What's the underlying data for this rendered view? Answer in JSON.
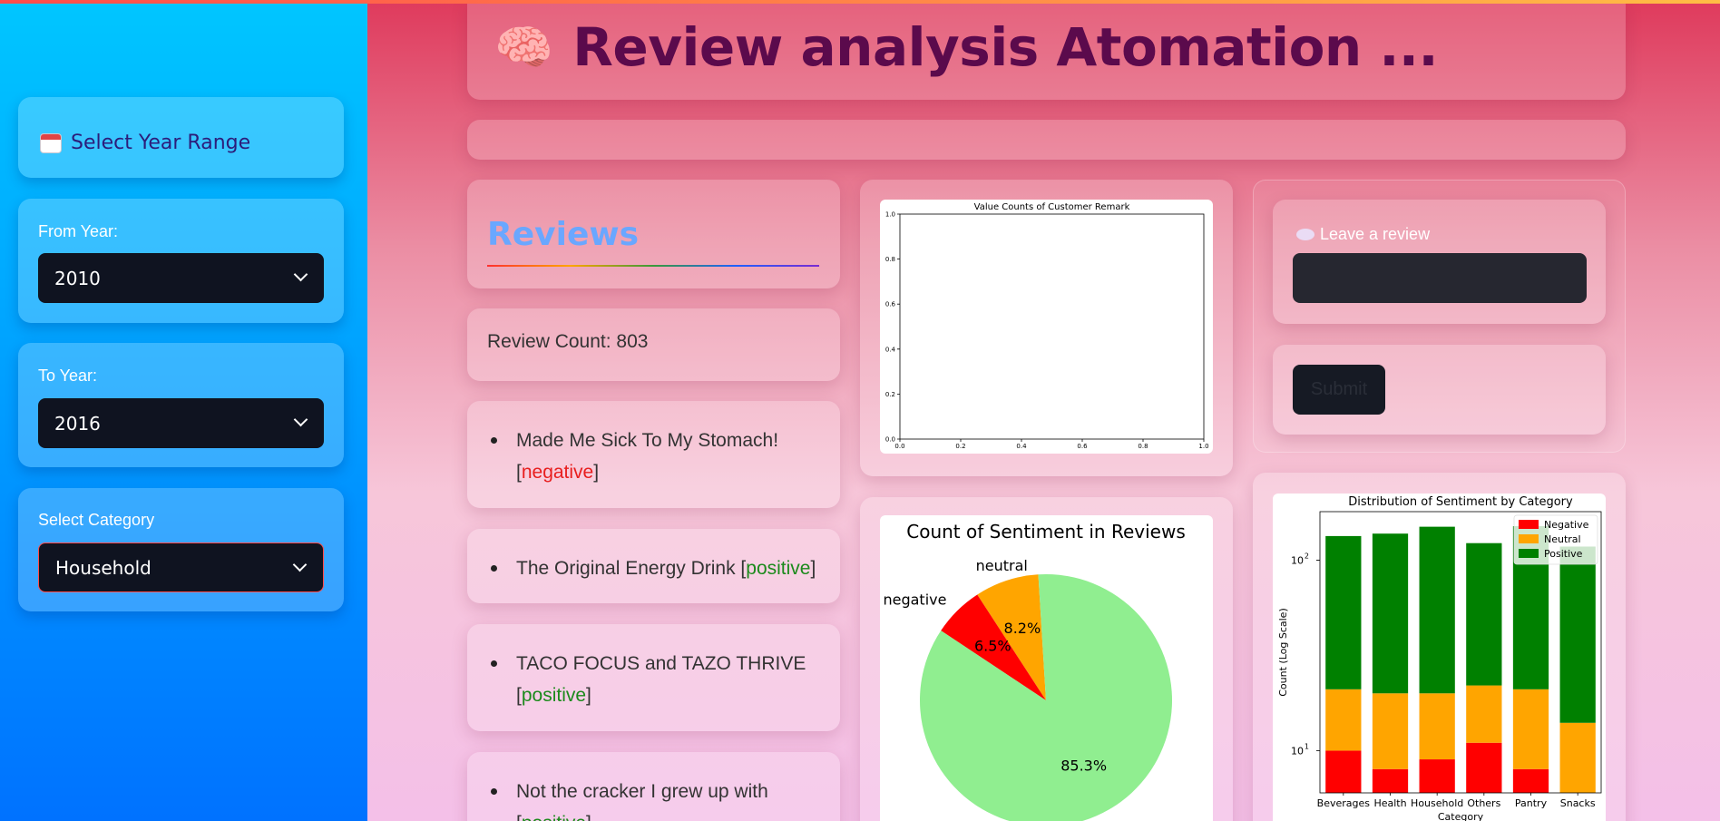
{
  "app": {
    "title": "Review analysis Atomation ...",
    "title_icon": "brain-icon"
  },
  "sidebar": {
    "year_range_title": "Select Year Range",
    "year_range_icon": "calendar-icon",
    "from_label": "From Year:",
    "from_value": "2010",
    "to_label": "To Year:",
    "to_value": "2016",
    "category_label": "Select Category",
    "category_value": "Household"
  },
  "reviews": {
    "heading": "Reviews",
    "count_text": "Review Count: 803",
    "items": [
      {
        "text": "Made Me Sick To My Stomach!",
        "sentiment": "negative"
      },
      {
        "text": "The Original Energy Drink",
        "sentiment": "positive"
      },
      {
        "text": "TACO FOCUS and TAZO THRIVE",
        "sentiment": "positive"
      },
      {
        "text": "Not the cracker I grew up with",
        "sentiment": "positive"
      }
    ]
  },
  "feedback": {
    "leave_label": "Leave a review",
    "leave_icon": "speech-bubble-icon",
    "input_value": "",
    "submit_label": "Submit"
  },
  "colors": {
    "negative": "#ff0000",
    "neutral": "#ffa500",
    "positive_pie": "#90ee90",
    "positive_bar": "#008000"
  },
  "chart_data": [
    {
      "type": "bar",
      "title": "Value Counts of Customer Remark",
      "xlabel": "",
      "ylabel": "",
      "categories": [],
      "values": [],
      "xlim": [
        0,
        1
      ],
      "ylim": [
        0,
        1
      ],
      "xticks": [
        "0.0",
        "0.2",
        "0.4",
        "0.6",
        "0.8",
        "1.0"
      ],
      "yticks": [
        "0.0",
        "0.2",
        "0.4",
        "0.6",
        "0.8",
        "1.0"
      ]
    },
    {
      "type": "pie",
      "title": "Count of Sentiment in Reviews",
      "labels": [
        "negative",
        "neutral",
        ""
      ],
      "values": [
        6.5,
        8.2,
        85.3
      ],
      "pct_labels": [
        "6.5%",
        "8.2%",
        "85.3%"
      ]
    },
    {
      "type": "bar",
      "stacked": true,
      "log_scale": true,
      "title": "Distribution of Sentiment by Category",
      "xlabel": "Category",
      "ylabel": "Count (Log Scale)",
      "legend_position": "top-right",
      "categories": [
        "Beverages",
        "Health",
        "Household",
        "Others",
        "Pantry",
        "Snacks"
      ],
      "ytick_labels": [
        "10",
        "10"
      ],
      "ytick_exponents": [
        "1",
        "2"
      ],
      "series": [
        {
          "name": "Negative",
          "values": [
            10,
            8,
            9,
            11,
            8,
            0
          ]
        },
        {
          "name": "Neutral",
          "values": [
            11,
            12,
            11,
            11,
            13,
            14
          ]
        },
        {
          "name": "Positive",
          "values": [
            113,
            118,
            130,
            101,
            130,
            104
          ]
        }
      ],
      "ylim": [
        6,
        180
      ]
    }
  ]
}
